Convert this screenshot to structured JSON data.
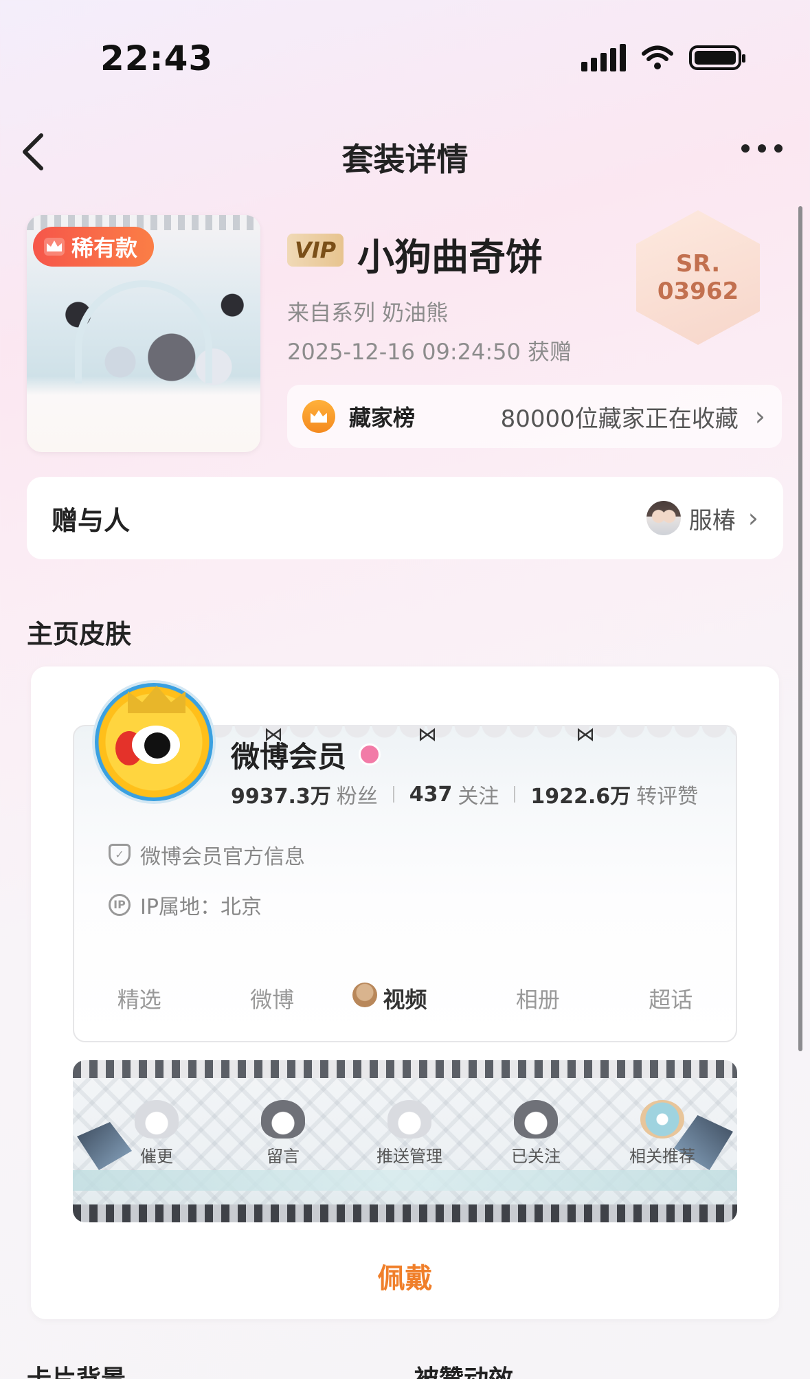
{
  "status_bar": {
    "time": "22:43"
  },
  "nav": {
    "title": "套装详情",
    "back_icon": "chevron-left-icon",
    "more_icon": "more-dots-icon"
  },
  "suit": {
    "rare_badge": "稀有款",
    "vip_badge": "VIP",
    "name": "小狗曲奇饼",
    "series": "来自系列 奶油熊",
    "received": "2025-12-16 09:24:50 获赠",
    "serial_prefix": "SR.",
    "serial_number": "03962"
  },
  "collector": {
    "label": "藏家榜",
    "count_text": "80000位藏家正在收藏"
  },
  "gifter": {
    "label": "赠与人",
    "name": "服椿"
  },
  "homepage_skin": {
    "section_title": "主页皮肤",
    "profile_name": "微博会员",
    "stats": [
      {
        "num": "9937.3万",
        "label": "粉丝"
      },
      {
        "num": "437",
        "label": "关注"
      },
      {
        "num": "1922.6万",
        "label": "转评赞"
      }
    ],
    "official_info": "微博会员官方信息",
    "ip_location": "IP属地：北京",
    "tabs": [
      "精选",
      "微博",
      "视频",
      "相册",
      "超话"
    ],
    "active_tab": "视频",
    "actions": [
      "催更",
      "留言",
      "推送管理",
      "已关注",
      "相关推荐"
    ],
    "wear_button": "佩戴"
  },
  "bottom_sections": [
    "卡片背景",
    "被赞动效"
  ],
  "colors": {
    "accent": "#f07f2a",
    "rare_badge": "#f6564a",
    "serial": "#c2704f"
  }
}
